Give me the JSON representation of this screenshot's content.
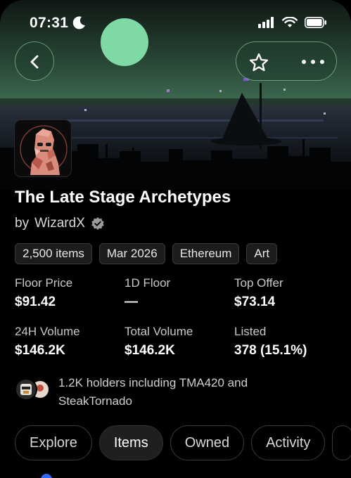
{
  "status_bar": {
    "time": "07:31",
    "icons": [
      "moon-icon",
      "cellular-signal-icon",
      "wifi-icon",
      "battery-icon"
    ]
  },
  "header": {
    "back_icon": "chevron-left-icon",
    "actions": [
      "star-icon",
      "more-horizontal-icon"
    ]
  },
  "collection": {
    "title": "The Late Stage Archetypes",
    "creator_prefix": "by",
    "creator": "WizardX",
    "verified_icon": "verified-badge-icon",
    "tags": [
      "2,500 items",
      "Mar 2026",
      "Ethereum",
      "Art"
    ]
  },
  "stats": [
    {
      "label": "Floor Price",
      "value": "$91.42"
    },
    {
      "label": "1D Floor",
      "value": "—"
    },
    {
      "label": "Top Offer",
      "value": "$73.14"
    },
    {
      "label": "24H Volume",
      "value": "$146.2K"
    },
    {
      "label": "Total Volume",
      "value": "$146.2K"
    },
    {
      "label": "Listed",
      "value": "378 (15.1%)"
    }
  ],
  "holders": {
    "text": "1.2K holders including TMA420 and SteakTornado"
  },
  "tabs": [
    {
      "label": "Explore",
      "active": false
    },
    {
      "label": "Items",
      "active": true
    },
    {
      "label": "Owned",
      "active": false
    },
    {
      "label": "Activity",
      "active": false
    }
  ],
  "colors": {
    "background": "#000000",
    "banner_green": "#7fd9a4",
    "accent_blue": "#2c6bff",
    "tag_bg": "#1c1c1e"
  }
}
